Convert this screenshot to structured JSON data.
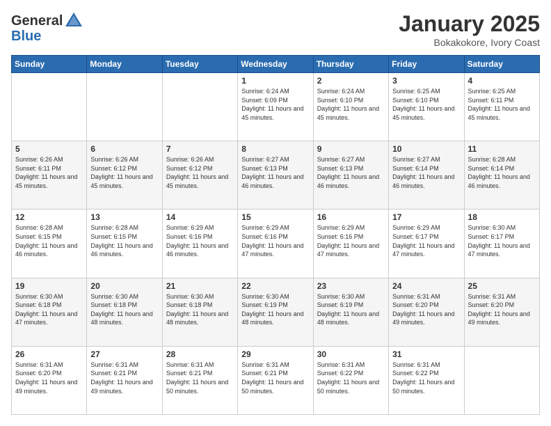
{
  "header": {
    "logo_general": "General",
    "logo_blue": "Blue",
    "month_title": "January 2025",
    "location": "Bokakokore, Ivory Coast"
  },
  "days_of_week": [
    "Sunday",
    "Monday",
    "Tuesday",
    "Wednesday",
    "Thursday",
    "Friday",
    "Saturday"
  ],
  "weeks": [
    [
      {
        "day": "",
        "info": ""
      },
      {
        "day": "",
        "info": ""
      },
      {
        "day": "",
        "info": ""
      },
      {
        "day": "1",
        "info": "Sunrise: 6:24 AM\nSunset: 6:09 PM\nDaylight: 11 hours and 45 minutes."
      },
      {
        "day": "2",
        "info": "Sunrise: 6:24 AM\nSunset: 6:10 PM\nDaylight: 11 hours and 45 minutes."
      },
      {
        "day": "3",
        "info": "Sunrise: 6:25 AM\nSunset: 6:10 PM\nDaylight: 11 hours and 45 minutes."
      },
      {
        "day": "4",
        "info": "Sunrise: 6:25 AM\nSunset: 6:11 PM\nDaylight: 11 hours and 45 minutes."
      }
    ],
    [
      {
        "day": "5",
        "info": "Sunrise: 6:26 AM\nSunset: 6:11 PM\nDaylight: 11 hours and 45 minutes."
      },
      {
        "day": "6",
        "info": "Sunrise: 6:26 AM\nSunset: 6:12 PM\nDaylight: 11 hours and 45 minutes."
      },
      {
        "day": "7",
        "info": "Sunrise: 6:26 AM\nSunset: 6:12 PM\nDaylight: 11 hours and 45 minutes."
      },
      {
        "day": "8",
        "info": "Sunrise: 6:27 AM\nSunset: 6:13 PM\nDaylight: 11 hours and 46 minutes."
      },
      {
        "day": "9",
        "info": "Sunrise: 6:27 AM\nSunset: 6:13 PM\nDaylight: 11 hours and 46 minutes."
      },
      {
        "day": "10",
        "info": "Sunrise: 6:27 AM\nSunset: 6:14 PM\nDaylight: 11 hours and 46 minutes."
      },
      {
        "day": "11",
        "info": "Sunrise: 6:28 AM\nSunset: 6:14 PM\nDaylight: 11 hours and 46 minutes."
      }
    ],
    [
      {
        "day": "12",
        "info": "Sunrise: 6:28 AM\nSunset: 6:15 PM\nDaylight: 11 hours and 46 minutes."
      },
      {
        "day": "13",
        "info": "Sunrise: 6:28 AM\nSunset: 6:15 PM\nDaylight: 11 hours and 46 minutes."
      },
      {
        "day": "14",
        "info": "Sunrise: 6:29 AM\nSunset: 6:16 PM\nDaylight: 11 hours and 46 minutes."
      },
      {
        "day": "15",
        "info": "Sunrise: 6:29 AM\nSunset: 6:16 PM\nDaylight: 11 hours and 47 minutes."
      },
      {
        "day": "16",
        "info": "Sunrise: 6:29 AM\nSunset: 6:16 PM\nDaylight: 11 hours and 47 minutes."
      },
      {
        "day": "17",
        "info": "Sunrise: 6:29 AM\nSunset: 6:17 PM\nDaylight: 11 hours and 47 minutes."
      },
      {
        "day": "18",
        "info": "Sunrise: 6:30 AM\nSunset: 6:17 PM\nDaylight: 11 hours and 47 minutes."
      }
    ],
    [
      {
        "day": "19",
        "info": "Sunrise: 6:30 AM\nSunset: 6:18 PM\nDaylight: 11 hours and 47 minutes."
      },
      {
        "day": "20",
        "info": "Sunrise: 6:30 AM\nSunset: 6:18 PM\nDaylight: 11 hours and 48 minutes."
      },
      {
        "day": "21",
        "info": "Sunrise: 6:30 AM\nSunset: 6:18 PM\nDaylight: 11 hours and 48 minutes."
      },
      {
        "day": "22",
        "info": "Sunrise: 6:30 AM\nSunset: 6:19 PM\nDaylight: 11 hours and 48 minutes."
      },
      {
        "day": "23",
        "info": "Sunrise: 6:30 AM\nSunset: 6:19 PM\nDaylight: 11 hours and 48 minutes."
      },
      {
        "day": "24",
        "info": "Sunrise: 6:31 AM\nSunset: 6:20 PM\nDaylight: 11 hours and 49 minutes."
      },
      {
        "day": "25",
        "info": "Sunrise: 6:31 AM\nSunset: 6:20 PM\nDaylight: 11 hours and 49 minutes."
      }
    ],
    [
      {
        "day": "26",
        "info": "Sunrise: 6:31 AM\nSunset: 6:20 PM\nDaylight: 11 hours and 49 minutes."
      },
      {
        "day": "27",
        "info": "Sunrise: 6:31 AM\nSunset: 6:21 PM\nDaylight: 11 hours and 49 minutes."
      },
      {
        "day": "28",
        "info": "Sunrise: 6:31 AM\nSunset: 6:21 PM\nDaylight: 11 hours and 50 minutes."
      },
      {
        "day": "29",
        "info": "Sunrise: 6:31 AM\nSunset: 6:21 PM\nDaylight: 11 hours and 50 minutes."
      },
      {
        "day": "30",
        "info": "Sunrise: 6:31 AM\nSunset: 6:22 PM\nDaylight: 11 hours and 50 minutes."
      },
      {
        "day": "31",
        "info": "Sunrise: 6:31 AM\nSunset: 6:22 PM\nDaylight: 11 hours and 50 minutes."
      },
      {
        "day": "",
        "info": ""
      }
    ]
  ]
}
